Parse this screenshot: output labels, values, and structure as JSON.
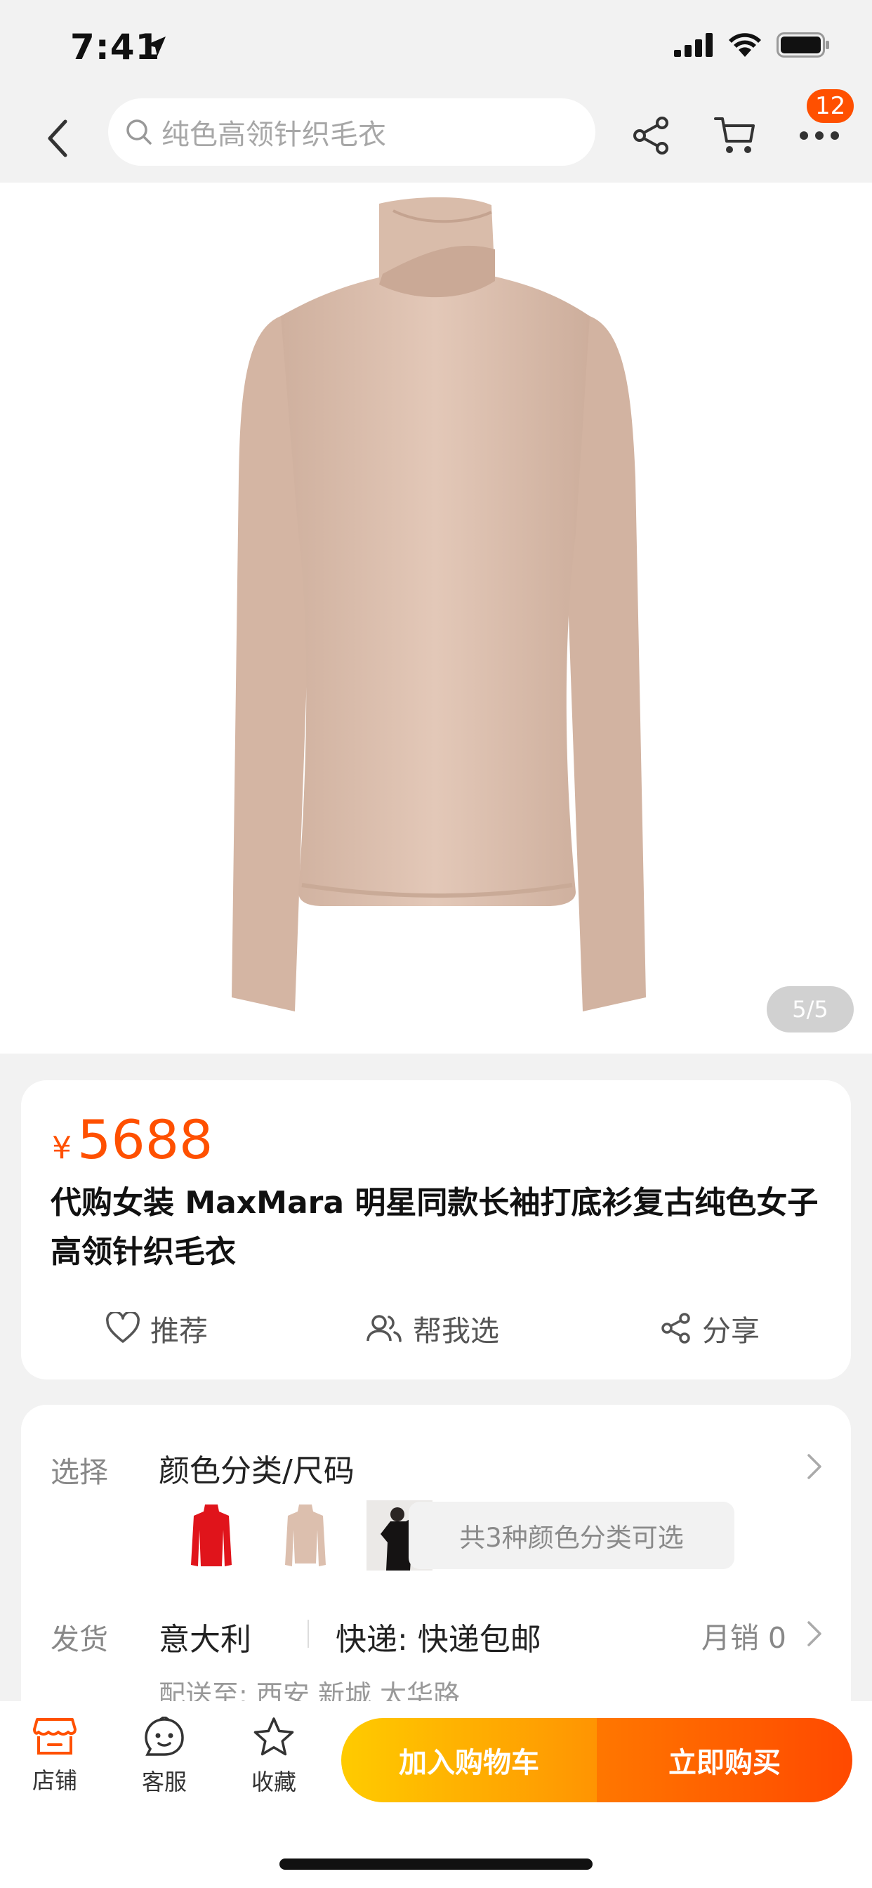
{
  "status_bar": {
    "time": "7:41"
  },
  "nav": {
    "search_placeholder": "纯色高领针织毛衣",
    "badge_count": "12"
  },
  "product_image": {
    "page_indicator": "5/5"
  },
  "product": {
    "currency": "¥",
    "price": "5688",
    "title": "代购女装 MaxMara 明星同款长袖打底衫复古纯色女子高领针织毛衣",
    "actions": {
      "recommend": "推荐",
      "help_choose": "帮我选",
      "share": "分享"
    }
  },
  "spec": {
    "choose_label": "选择",
    "choose_value": "颜色分类/尺码",
    "color_count": "共3种颜色分类可选",
    "ship_label": "发货",
    "ship_from": "意大利",
    "express": "快递: 快递包邮",
    "monthly_sales": "月销 0",
    "deliver_to": "配送至: 西安 新城 太华路"
  },
  "bottom_bar": {
    "shop": "店铺",
    "service": "客服",
    "favorite": "收藏",
    "add_to_cart": "加入购物车",
    "buy_now": "立即购买"
  },
  "colors": {
    "accent": "#ff5000",
    "cart_button": "#ffb200",
    "buy_button": "#ff5a00",
    "sweater_beige": "#dcbfae"
  }
}
